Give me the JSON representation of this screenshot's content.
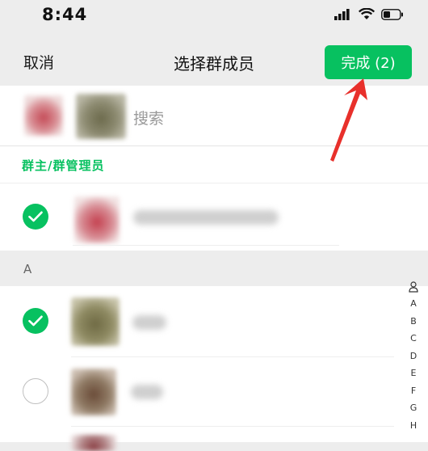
{
  "status": {
    "time": "8:44"
  },
  "nav": {
    "cancel": "取消",
    "title": "选择群成员",
    "done": "完成 (2)"
  },
  "search": {
    "placeholder": "搜索"
  },
  "sections": {
    "admins": "群主/群管理员",
    "letter": "A"
  },
  "index_letters": [
    "A",
    "B",
    "C",
    "D",
    "E",
    "F",
    "G",
    "H"
  ],
  "colors": {
    "accent": "#07c160",
    "arrow": "#e53935"
  }
}
